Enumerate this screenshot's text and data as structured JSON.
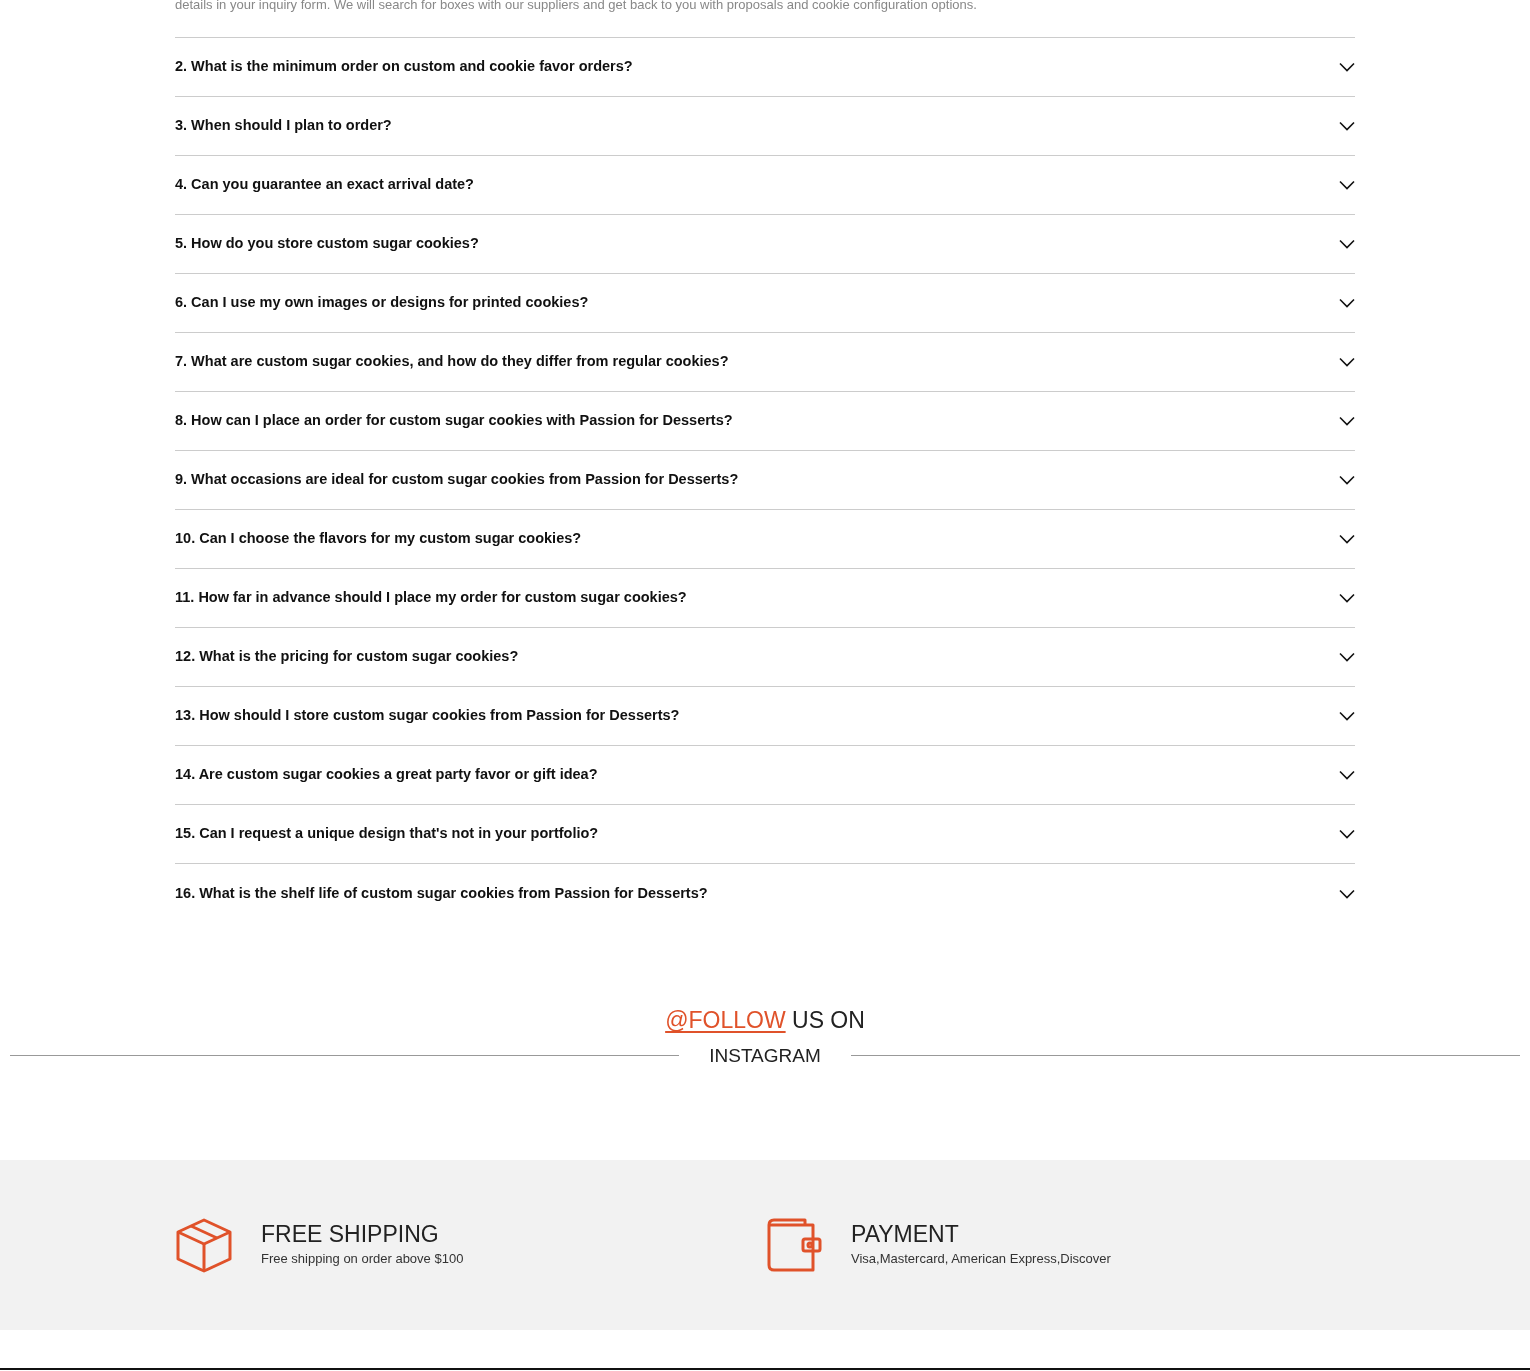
{
  "faq": {
    "open_answer": "details in your inquiry form. We will search for boxes with our suppliers and get back to you with proposals and cookie configuration options.",
    "items": [
      {
        "question": "2. What is the minimum order on custom and cookie favor orders?",
        "expanded": false
      },
      {
        "question": "3. When should I plan to order?",
        "expanded": false
      },
      {
        "question": "4. Can you guarantee an exact arrival date?",
        "expanded": false
      },
      {
        "question": "5. How do you store custom sugar cookies?",
        "expanded": false
      },
      {
        "question": "6. Can I use my own images or designs for printed cookies?",
        "expanded": false
      },
      {
        "question": "7. What are custom sugar cookies, and how do they differ from regular cookies?",
        "expanded": false
      },
      {
        "question": "8. How can I place an order for custom sugar cookies with Passion for Desserts?",
        "expanded": false
      },
      {
        "question": "9. What occasions are ideal for custom sugar cookies from Passion for Desserts?",
        "expanded": false
      },
      {
        "question": "10. Can I choose the flavors for my custom sugar cookies?",
        "expanded": false
      },
      {
        "question": "11. How far in advance should I place my order for custom sugar cookies?",
        "expanded": false
      },
      {
        "question": "12. What is the pricing for custom sugar cookies?",
        "expanded": false
      },
      {
        "question": "13. How should I store custom sugar cookies from Passion for Desserts?",
        "expanded": false
      },
      {
        "question": "14. Are custom sugar cookies a great party favor or gift idea?",
        "expanded": false
      },
      {
        "question": "15. Can I request a unique design that's not in your portfolio?",
        "expanded": false
      },
      {
        "question": "16. What is the shelf life of custom sugar cookies from Passion for Desserts?",
        "expanded": false
      }
    ]
  },
  "instagram": {
    "link": "@FOLLOW",
    "title_rest": "US ON",
    "subtitle": "INSTAGRAM"
  },
  "features": [
    {
      "kind": "shipping",
      "title": "FREE SHIPPING",
      "text": "Free shipping on order above $100"
    },
    {
      "kind": "payment",
      "title": "PAYMENT",
      "text": "Visa,Mastercard, American Express,Discover"
    }
  ]
}
